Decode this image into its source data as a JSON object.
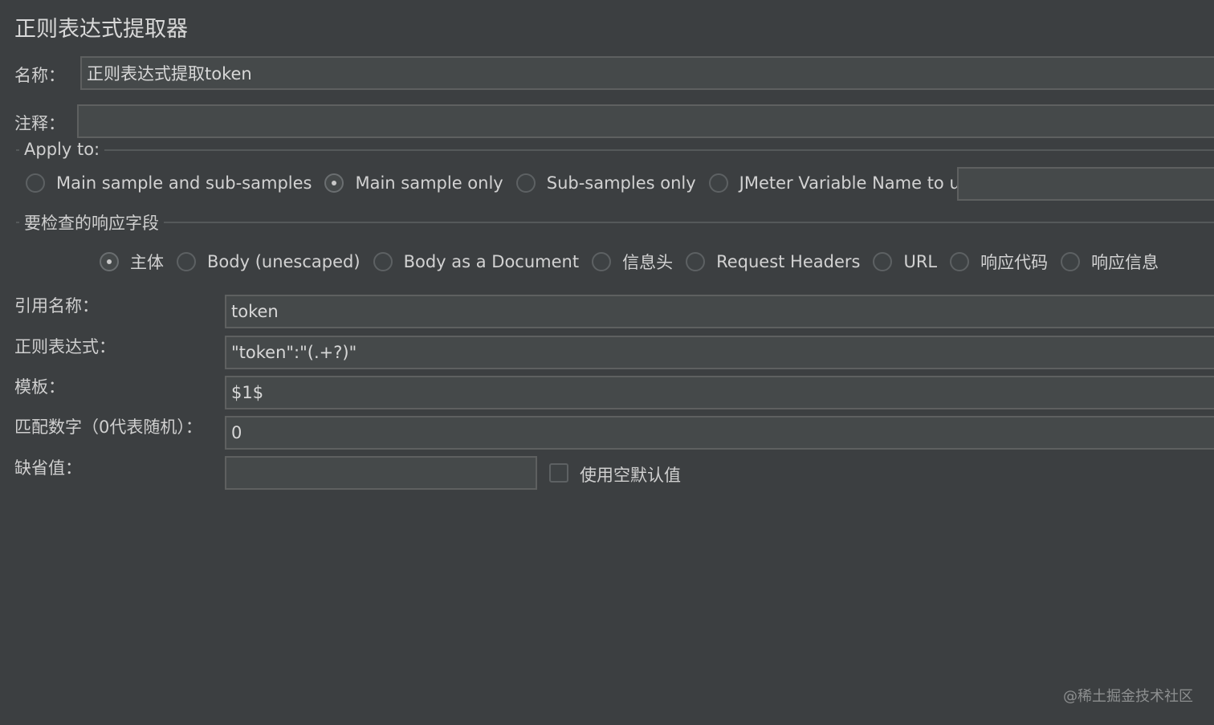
{
  "title": "正则表达式提取器",
  "name": {
    "label": "名称：",
    "value": "正则表达式提取token"
  },
  "comment": {
    "label": "注释：",
    "value": ""
  },
  "apply_to": {
    "title": "Apply to:",
    "options": [
      "Main sample and sub-samples",
      "Main sample only",
      "Sub-samples only",
      "JMeter Variable Name to use"
    ],
    "selected": "Main sample only",
    "variable_name_value": ""
  },
  "field_to_check": {
    "title": "要检查的响应字段",
    "options": [
      "主体",
      "Body (unescaped)",
      "Body as a Document",
      "信息头",
      "Request Headers",
      "URL",
      "响应代码",
      "响应信息"
    ],
    "selected": "主体"
  },
  "ref_name": {
    "label": "引用名称：",
    "value": "token"
  },
  "regex": {
    "label": "正则表达式：",
    "value": "\"token\":\"(.+?)\""
  },
  "template": {
    "label": "模板：",
    "value": "$1$"
  },
  "match_no": {
    "label": "匹配数字（0代表随机）：",
    "value": "0"
  },
  "default_value": {
    "label": "缺省值：",
    "value": "",
    "use_empty_label": "使用空默认值",
    "use_empty_checked": false
  },
  "watermark": "@稀土掘金技术社区"
}
